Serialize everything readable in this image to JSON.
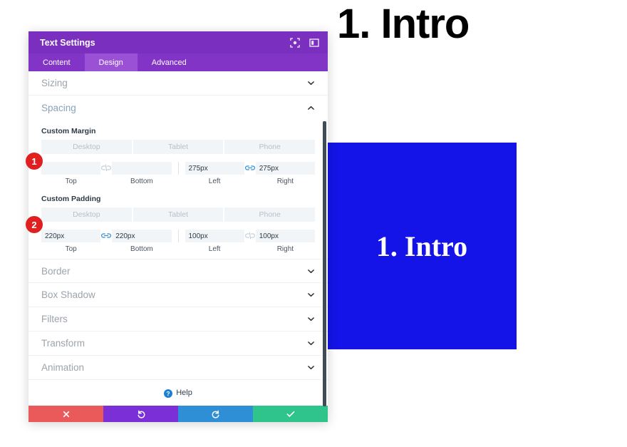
{
  "page": {
    "top_heading": "1. Intro",
    "module": {
      "text": "1. Intro",
      "background_color": "#1414e8",
      "text_color": "#ffffff"
    }
  },
  "modal": {
    "title": "Text Settings",
    "header_icons": [
      {
        "name": "expand-icon",
        "glyph": "expand"
      },
      {
        "name": "layout-toggle-icon",
        "glyph": "layout"
      }
    ],
    "tabs": [
      {
        "label": "Content",
        "active": false
      },
      {
        "label": "Design",
        "active": true
      },
      {
        "label": "Advanced",
        "active": false
      }
    ],
    "sections": [
      {
        "label": "Sizing",
        "open": false
      },
      {
        "label": "Spacing",
        "open": true
      },
      {
        "label": "Border",
        "open": false
      },
      {
        "label": "Box Shadow",
        "open": false
      },
      {
        "label": "Filters",
        "open": false
      },
      {
        "label": "Transform",
        "open": false
      },
      {
        "label": "Animation",
        "open": false
      }
    ],
    "spacing": {
      "custom_margin": {
        "label": "Custom Margin",
        "devices": [
          "Desktop",
          "Tablet",
          "Phone"
        ],
        "active_device": "Desktop",
        "top_bottom_linked": false,
        "left_right_linked": true,
        "fields": [
          {
            "caption": "Top",
            "value": "",
            "placeholder": ""
          },
          {
            "caption": "Bottom",
            "value": "",
            "placeholder": ""
          },
          {
            "caption": "Left",
            "value": "275px",
            "placeholder": ""
          },
          {
            "caption": "Right",
            "value": "275px",
            "placeholder": ""
          }
        ]
      },
      "custom_padding": {
        "label": "Custom Padding",
        "devices": [
          "Desktop",
          "Tablet",
          "Phone"
        ],
        "active_device": "Desktop",
        "top_bottom_linked": true,
        "left_right_linked": false,
        "fields": [
          {
            "caption": "Top",
            "value": "220px",
            "placeholder": ""
          },
          {
            "caption": "Bottom",
            "value": "220px",
            "placeholder": ""
          },
          {
            "caption": "Left",
            "value": "100px",
            "placeholder": ""
          },
          {
            "caption": "Right",
            "value": "100px",
            "placeholder": ""
          }
        ]
      }
    },
    "help": {
      "label": "Help"
    },
    "footer_buttons": [
      {
        "name": "cancel",
        "icon": "close-icon",
        "color": "#ea5a5a"
      },
      {
        "name": "undo",
        "icon": "undo-icon",
        "color": "#7b2fd6"
      },
      {
        "name": "redo",
        "icon": "redo-icon",
        "color": "#2e8ed6"
      },
      {
        "name": "save",
        "icon": "checkmark-icon",
        "color": "#30c48d"
      }
    ]
  },
  "annotations": [
    {
      "number": "1",
      "target": "custom-margin-row"
    },
    {
      "number": "2",
      "target": "custom-padding-row"
    }
  ]
}
